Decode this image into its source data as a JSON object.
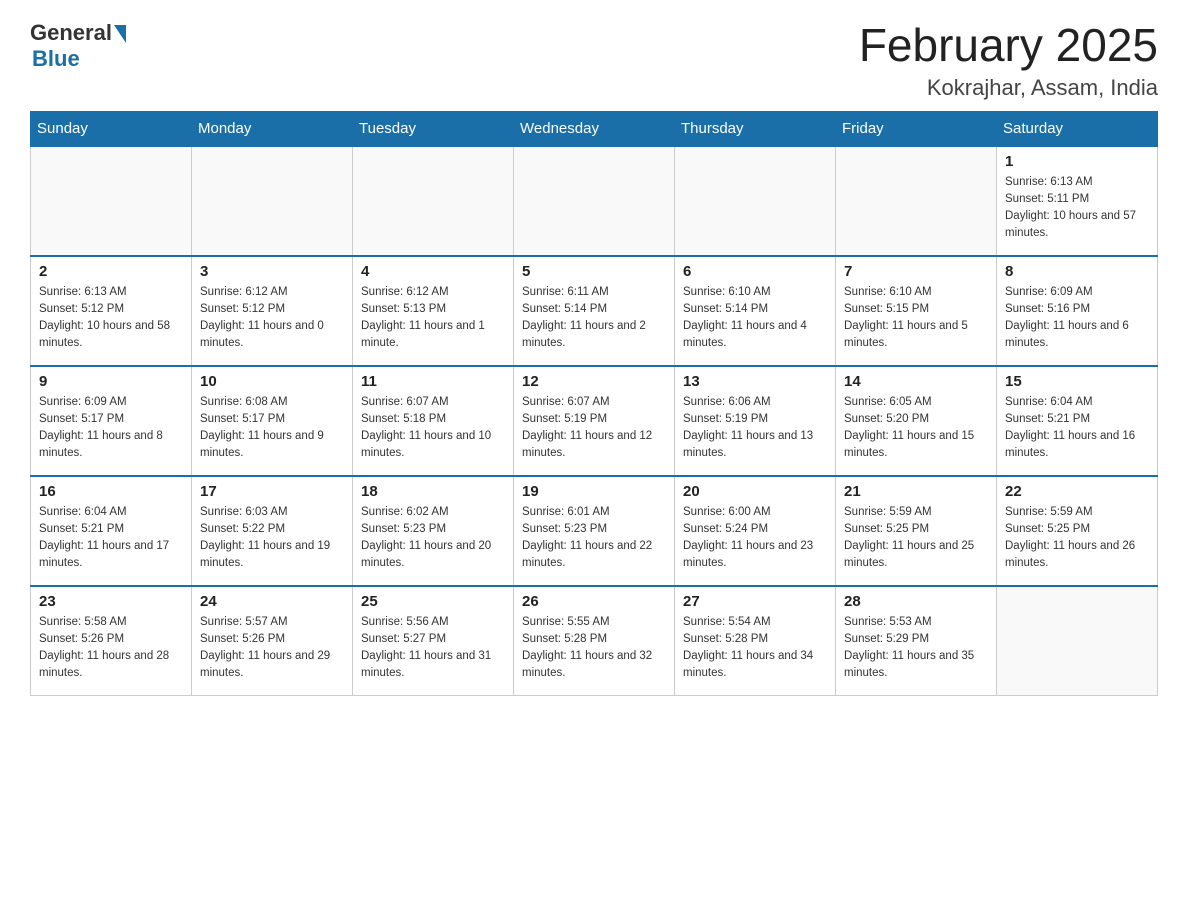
{
  "header": {
    "logo_general": "General",
    "logo_blue": "Blue",
    "title": "February 2025",
    "subtitle": "Kokrajhar, Assam, India"
  },
  "days_of_week": [
    "Sunday",
    "Monday",
    "Tuesday",
    "Wednesday",
    "Thursday",
    "Friday",
    "Saturday"
  ],
  "weeks": [
    {
      "days": [
        {
          "number": "",
          "info": ""
        },
        {
          "number": "",
          "info": ""
        },
        {
          "number": "",
          "info": ""
        },
        {
          "number": "",
          "info": ""
        },
        {
          "number": "",
          "info": ""
        },
        {
          "number": "",
          "info": ""
        },
        {
          "number": "1",
          "info": "Sunrise: 6:13 AM\nSunset: 5:11 PM\nDaylight: 10 hours and 57 minutes."
        }
      ]
    },
    {
      "days": [
        {
          "number": "2",
          "info": "Sunrise: 6:13 AM\nSunset: 5:12 PM\nDaylight: 10 hours and 58 minutes."
        },
        {
          "number": "3",
          "info": "Sunrise: 6:12 AM\nSunset: 5:12 PM\nDaylight: 11 hours and 0 minutes."
        },
        {
          "number": "4",
          "info": "Sunrise: 6:12 AM\nSunset: 5:13 PM\nDaylight: 11 hours and 1 minute."
        },
        {
          "number": "5",
          "info": "Sunrise: 6:11 AM\nSunset: 5:14 PM\nDaylight: 11 hours and 2 minutes."
        },
        {
          "number": "6",
          "info": "Sunrise: 6:10 AM\nSunset: 5:14 PM\nDaylight: 11 hours and 4 minutes."
        },
        {
          "number": "7",
          "info": "Sunrise: 6:10 AM\nSunset: 5:15 PM\nDaylight: 11 hours and 5 minutes."
        },
        {
          "number": "8",
          "info": "Sunrise: 6:09 AM\nSunset: 5:16 PM\nDaylight: 11 hours and 6 minutes."
        }
      ]
    },
    {
      "days": [
        {
          "number": "9",
          "info": "Sunrise: 6:09 AM\nSunset: 5:17 PM\nDaylight: 11 hours and 8 minutes."
        },
        {
          "number": "10",
          "info": "Sunrise: 6:08 AM\nSunset: 5:17 PM\nDaylight: 11 hours and 9 minutes."
        },
        {
          "number": "11",
          "info": "Sunrise: 6:07 AM\nSunset: 5:18 PM\nDaylight: 11 hours and 10 minutes."
        },
        {
          "number": "12",
          "info": "Sunrise: 6:07 AM\nSunset: 5:19 PM\nDaylight: 11 hours and 12 minutes."
        },
        {
          "number": "13",
          "info": "Sunrise: 6:06 AM\nSunset: 5:19 PM\nDaylight: 11 hours and 13 minutes."
        },
        {
          "number": "14",
          "info": "Sunrise: 6:05 AM\nSunset: 5:20 PM\nDaylight: 11 hours and 15 minutes."
        },
        {
          "number": "15",
          "info": "Sunrise: 6:04 AM\nSunset: 5:21 PM\nDaylight: 11 hours and 16 minutes."
        }
      ]
    },
    {
      "days": [
        {
          "number": "16",
          "info": "Sunrise: 6:04 AM\nSunset: 5:21 PM\nDaylight: 11 hours and 17 minutes."
        },
        {
          "number": "17",
          "info": "Sunrise: 6:03 AM\nSunset: 5:22 PM\nDaylight: 11 hours and 19 minutes."
        },
        {
          "number": "18",
          "info": "Sunrise: 6:02 AM\nSunset: 5:23 PM\nDaylight: 11 hours and 20 minutes."
        },
        {
          "number": "19",
          "info": "Sunrise: 6:01 AM\nSunset: 5:23 PM\nDaylight: 11 hours and 22 minutes."
        },
        {
          "number": "20",
          "info": "Sunrise: 6:00 AM\nSunset: 5:24 PM\nDaylight: 11 hours and 23 minutes."
        },
        {
          "number": "21",
          "info": "Sunrise: 5:59 AM\nSunset: 5:25 PM\nDaylight: 11 hours and 25 minutes."
        },
        {
          "number": "22",
          "info": "Sunrise: 5:59 AM\nSunset: 5:25 PM\nDaylight: 11 hours and 26 minutes."
        }
      ]
    },
    {
      "days": [
        {
          "number": "23",
          "info": "Sunrise: 5:58 AM\nSunset: 5:26 PM\nDaylight: 11 hours and 28 minutes."
        },
        {
          "number": "24",
          "info": "Sunrise: 5:57 AM\nSunset: 5:26 PM\nDaylight: 11 hours and 29 minutes."
        },
        {
          "number": "25",
          "info": "Sunrise: 5:56 AM\nSunset: 5:27 PM\nDaylight: 11 hours and 31 minutes."
        },
        {
          "number": "26",
          "info": "Sunrise: 5:55 AM\nSunset: 5:28 PM\nDaylight: 11 hours and 32 minutes."
        },
        {
          "number": "27",
          "info": "Sunrise: 5:54 AM\nSunset: 5:28 PM\nDaylight: 11 hours and 34 minutes."
        },
        {
          "number": "28",
          "info": "Sunrise: 5:53 AM\nSunset: 5:29 PM\nDaylight: 11 hours and 35 minutes."
        },
        {
          "number": "",
          "info": ""
        }
      ]
    }
  ]
}
